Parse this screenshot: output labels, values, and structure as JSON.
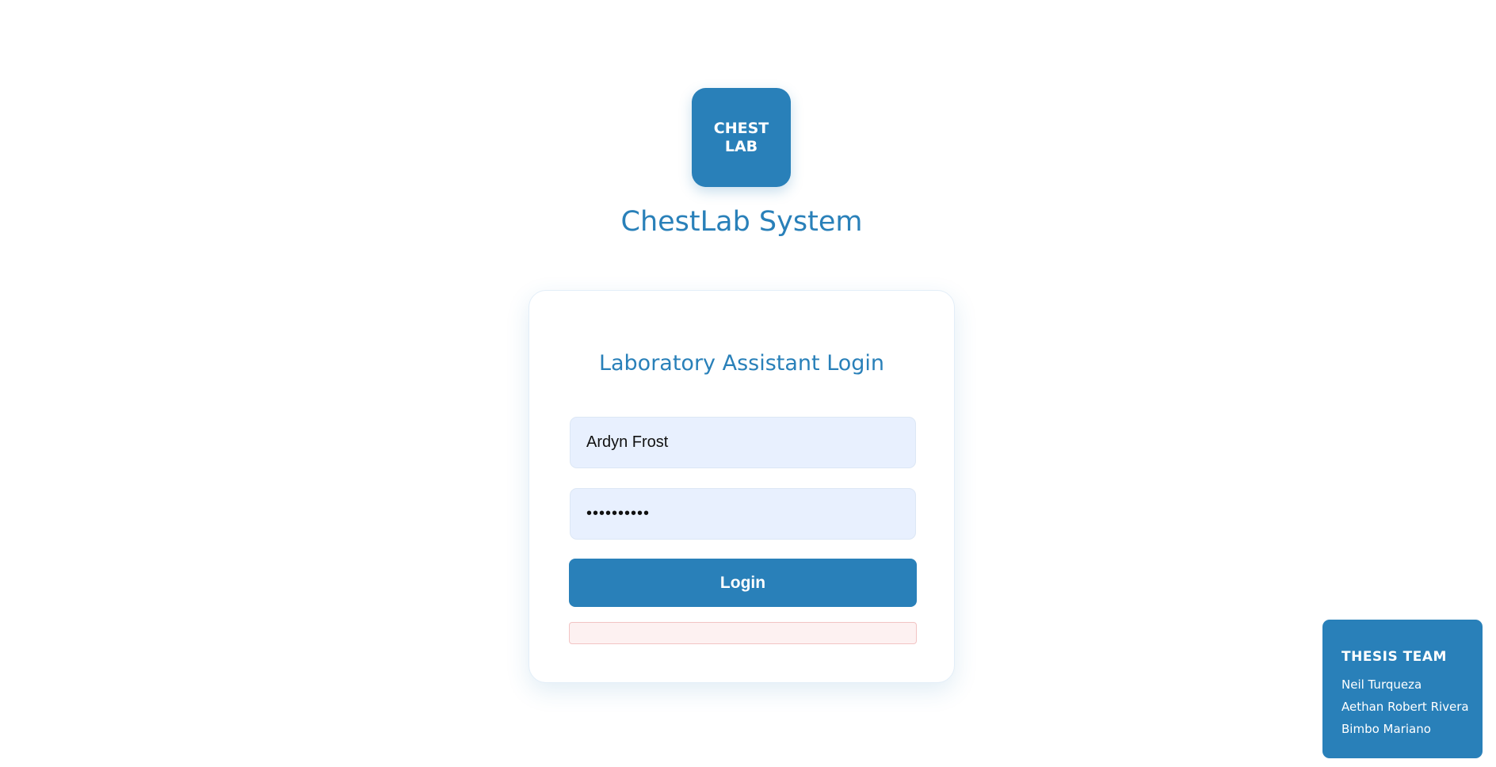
{
  "logo": {
    "line1": "CHEST",
    "line2": "LAB"
  },
  "app_title": "ChestLab System",
  "login_card": {
    "title": "Laboratory Assistant Login",
    "username_value": "Ardyn Frost",
    "password_value": "••••••••••",
    "login_label": "Login",
    "error_message": ""
  },
  "thesis_team": {
    "title": "THESIS TEAM",
    "members": [
      "Neil Turqueza",
      "Aethan Robert Rivera",
      "Bimbo Mariano"
    ]
  },
  "colors": {
    "brand": "#2980b9",
    "input_bg": "#e8f0fe",
    "error_bg": "#fdf1f1",
    "error_border": "#f2c4c4"
  }
}
